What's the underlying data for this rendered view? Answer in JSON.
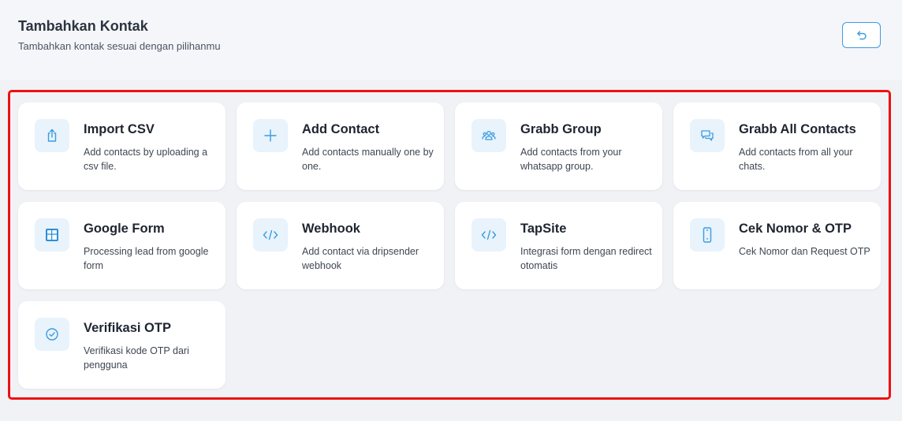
{
  "header": {
    "title": "Tambahkan Kontak",
    "subtitle": "Tambahkan kontak sesuai dengan pilihanmu",
    "back_icon": "undo-arrow-icon"
  },
  "accent_color": "#3b9be0",
  "selection_color": "#ee1111",
  "cards": [
    {
      "title": "Import CSV",
      "desc": "Add contacts by uploading a csv file.",
      "icon": "upload-icon"
    },
    {
      "title": "Add Contact",
      "desc": "Add contacts manually one by one.",
      "icon": "plus-icon"
    },
    {
      "title": "Grabb Group",
      "desc": "Add contacts from your whatsapp group.",
      "icon": "users-icon"
    },
    {
      "title": "Grabb All Contacts",
      "desc": "Add contacts from all your chats.",
      "icon": "chat-bubbles-icon"
    },
    {
      "title": "Google Form",
      "desc": "Processing lead from google form",
      "icon": "google-form-icon"
    },
    {
      "title": "Webhook",
      "desc": "Add contact via dripsender webhook",
      "icon": "code-icon"
    },
    {
      "title": "TapSite",
      "desc": "Integrasi form dengan redirect otomatis",
      "icon": "code-icon"
    },
    {
      "title": "Cek Nomor & OTP",
      "desc": "Cek Nomor dan Request OTP",
      "icon": "phone-icon"
    },
    {
      "title": "Verifikasi OTP",
      "desc": "Verifikasi kode OTP dari pengguna",
      "icon": "check-circle-icon"
    }
  ]
}
